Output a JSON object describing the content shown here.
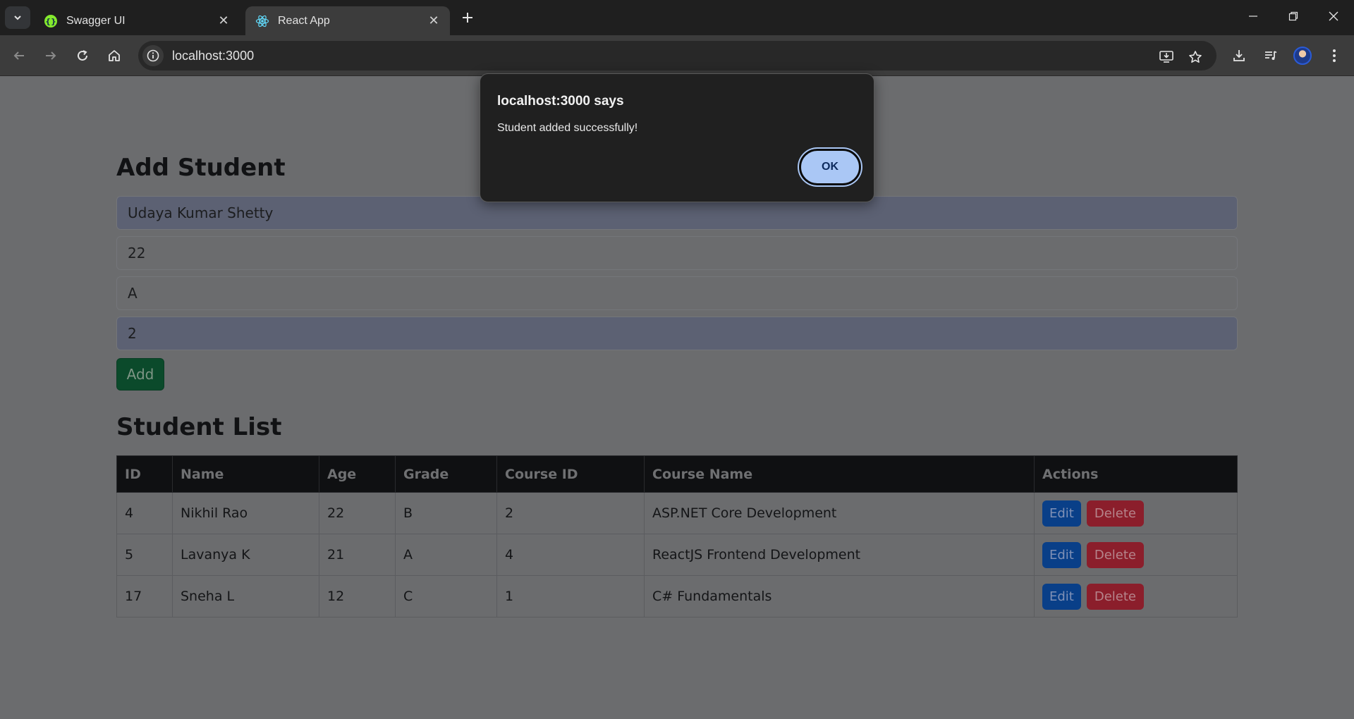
{
  "browser": {
    "tabs": [
      {
        "title": "Swagger UI",
        "active": false
      },
      {
        "title": "React App",
        "active": true
      }
    ],
    "url": "localhost:3000"
  },
  "page": {
    "add_section": {
      "heading": "Add Student",
      "fields": [
        {
          "value": "Udaya Kumar Shetty",
          "autofilled": true
        },
        {
          "value": "22",
          "autofilled": false
        },
        {
          "value": "A",
          "autofilled": false
        },
        {
          "value": "2",
          "autofilled": true
        }
      ],
      "add_label": "Add"
    },
    "list_section": {
      "heading": "Student List",
      "columns": [
        "ID",
        "Name",
        "Age",
        "Grade",
        "Course ID",
        "Course Name",
        "Actions"
      ],
      "rows": [
        {
          "id": "4",
          "name": "Nikhil Rao",
          "age": "22",
          "grade": "B",
          "course_id": "2",
          "course_name": "ASP.NET Core Development"
        },
        {
          "id": "5",
          "name": "Lavanya K",
          "age": "21",
          "grade": "A",
          "course_id": "4",
          "course_name": "ReactJS Frontend Development"
        },
        {
          "id": "17",
          "name": "Sneha L",
          "age": "12",
          "grade": "C",
          "course_id": "1",
          "course_name": "C# Fundamentals"
        }
      ],
      "edit_label": "Edit",
      "delete_label": "Delete"
    }
  },
  "dialog": {
    "title": "localhost:3000 says",
    "message": "Student added successfully!",
    "ok_label": "OK"
  },
  "colors": {
    "accent_ok": "#aac7f5",
    "edit": "#093f88",
    "delete": "#8b1e2b",
    "add": "#0b4a2b"
  }
}
